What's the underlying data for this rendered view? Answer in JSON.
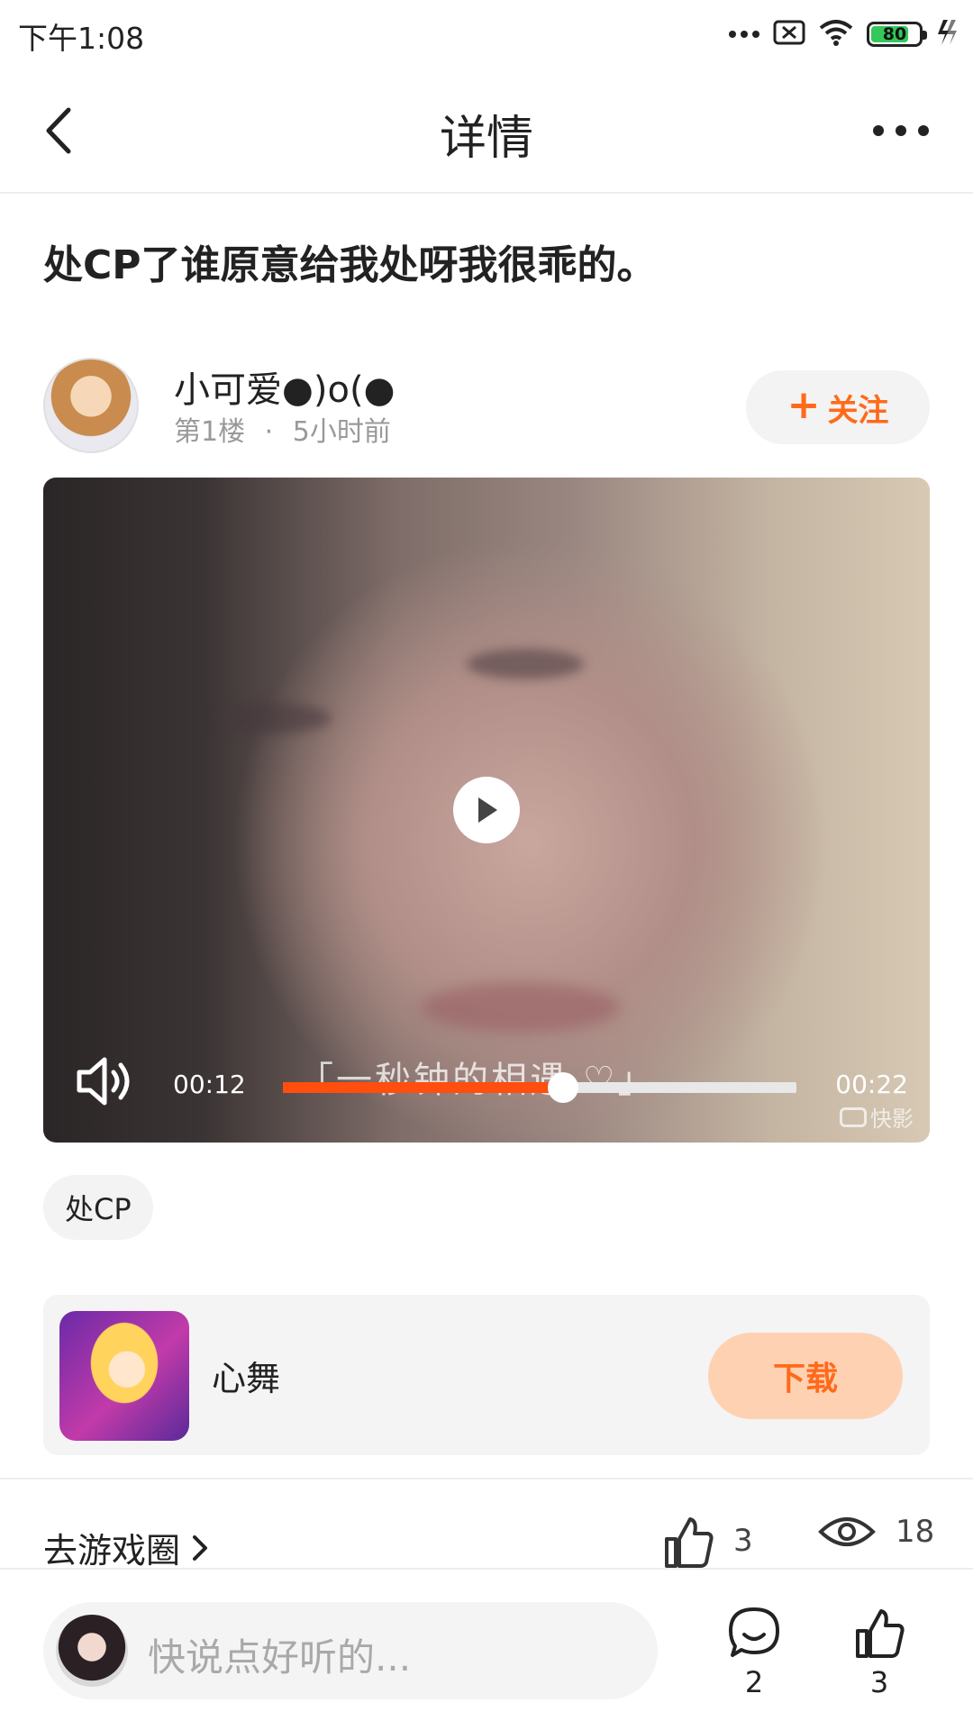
{
  "status_bar": {
    "time": "下午1:08",
    "battery_level": 80,
    "battery_label": "80",
    "icons": [
      "more-dots-icon",
      "sim-x-icon",
      "wifi-icon",
      "battery-icon",
      "charging-icon"
    ]
  },
  "nav": {
    "title": "详情",
    "back_icon": "chevron-left-icon",
    "more_icon": "more-horizontal-icon"
  },
  "post": {
    "title": "处CP了谁原意给我处呀我很乖的。",
    "author": {
      "name": "小可爱●)o(●",
      "floor": "第1楼",
      "separator": "·",
      "time": "5小时前"
    },
    "follow_label": "关注"
  },
  "video": {
    "current_time": "00:12",
    "total_time": "00:22",
    "progress": 0.545,
    "subtitle": "「一秒钟的相遇 ♡」",
    "watermark": "快影"
  },
  "tags": [
    "处CP"
  ],
  "game": {
    "name": "心舞",
    "download_label": "下载"
  },
  "stats": {
    "game_circle_link": "去游戏圈",
    "likes": "3",
    "views": "18"
  },
  "bottom_bar": {
    "comment_placeholder": "快说点好听的...",
    "comment_count": "2",
    "like_count": "3"
  },
  "colors": {
    "accent": "#ff6a1a",
    "progress": "#ff4e0d",
    "download_bg": "#ffd1b3",
    "battery": "#34c759"
  }
}
